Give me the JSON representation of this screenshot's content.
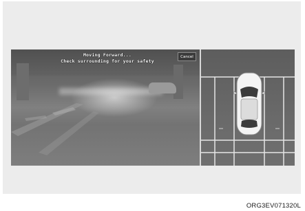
{
  "camera_view": {
    "message_line1": "Moving Forward...",
    "message_line2": "Check surrounding for your safety",
    "cancel_label": "Cancel"
  },
  "top_view": {
    "vehicle": "car-top-view-icon"
  },
  "caption": "ORG3EV071320L"
}
